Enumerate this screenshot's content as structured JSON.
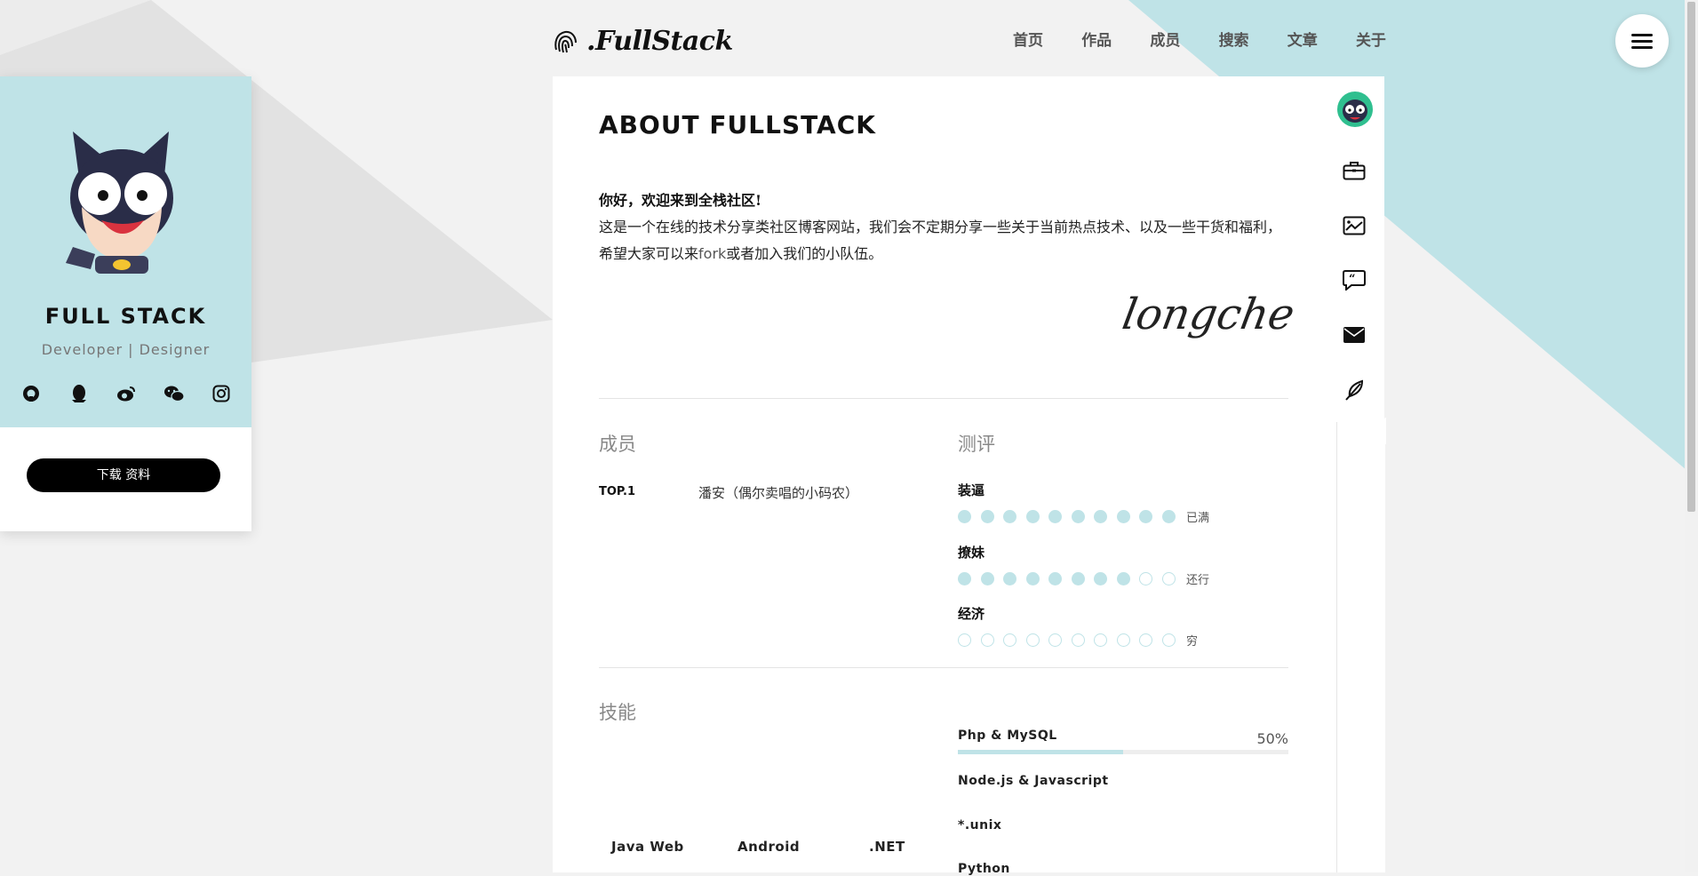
{
  "header": {
    "logo_text": ".FullStack",
    "nav": [
      "首页",
      "作品",
      "成员",
      "搜索",
      "文章",
      "关于"
    ]
  },
  "profile": {
    "name": "FULL STACK",
    "role": "Developer | Designer",
    "social_icons": [
      "github-icon",
      "qq-icon",
      "weibo-icon",
      "wechat-icon",
      "instagram-icon"
    ],
    "download_label": "下载 资料"
  },
  "main": {
    "title": "ABOUT FULLSTACK",
    "greeting": "你好，欢迎来到全栈社区!",
    "intro_before": "这是一个在线的技术分享类社区博客网站，我们会不定期分享一些关于当前热点技术、以及一些干货和福利，希望大家可以来",
    "intro_link": "fork",
    "intro_after": "或者加入我们的小队伍。",
    "signature": "longche"
  },
  "members": {
    "heading": "成员",
    "rank": "TOP.1",
    "name": "潘安（偶尔卖唱的小码农）"
  },
  "ratings": {
    "heading": "测评",
    "items": [
      {
        "label": "装逼",
        "value": 10,
        "max": 10,
        "note": "已满"
      },
      {
        "label": "撩妹",
        "value": 8,
        "max": 10,
        "note": "还行"
      },
      {
        "label": "经济",
        "value": 0,
        "max": 10,
        "note": "穷"
      }
    ]
  },
  "skills": {
    "heading": "技能",
    "items": [
      {
        "name": "Php & MySQL",
        "percent_label": "50%",
        "level": 0.5
      },
      {
        "name": "Node.js & Javascript"
      },
      {
        "name": "*.unix"
      },
      {
        "name": "Python"
      }
    ],
    "platforms": [
      "Java Web",
      "Android",
      ".NET"
    ]
  },
  "side_rail_icons": [
    "member-avatar-icon",
    "briefcase-icon",
    "image-icon",
    "quote-icon",
    "mail-icon",
    "feather-icon"
  ],
  "colors": {
    "accent": "#bfe3e7",
    "background": "#f2f2f2",
    "button": "#000000"
  }
}
